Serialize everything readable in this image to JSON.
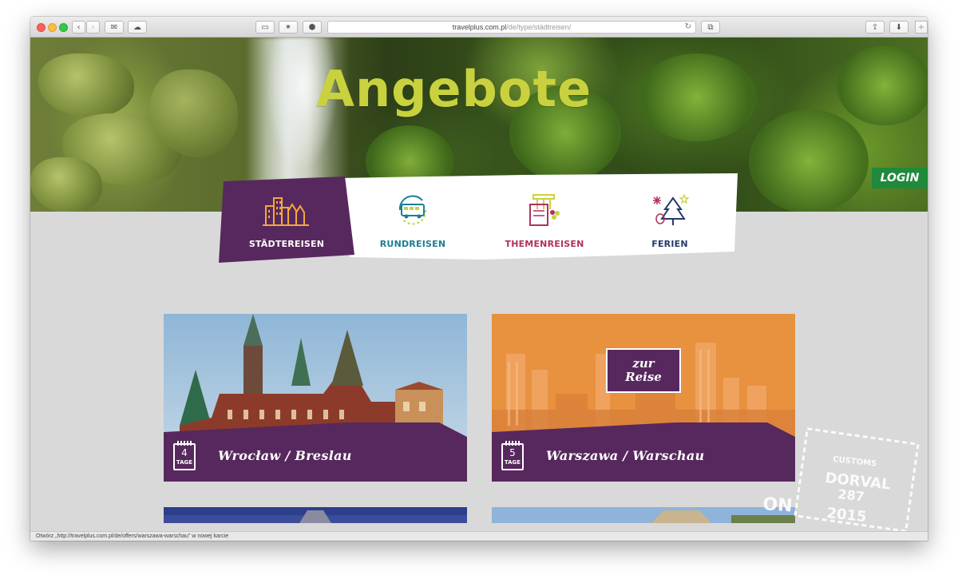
{
  "browser": {
    "url_host": "travelplus.com.pl",
    "url_path": "/de/type/städtreisen/",
    "status": "Otwórz „http://travelplus.com.pl/de/offers/warszawa-warschau\" w nowej karcie"
  },
  "hero": {
    "title": "Angebote",
    "login_label": "LOGIN"
  },
  "categories": [
    {
      "label": "STÄDTEREISEN",
      "icon": "city-buildings-icon",
      "active": true
    },
    {
      "label": "RUNDREISEN",
      "icon": "bus-circle-icon",
      "active": false
    },
    {
      "label": "THEMENREISEN",
      "icon": "columns-book-icon",
      "active": false
    },
    {
      "label": "FERIEN",
      "icon": "tree-fireworks-icon",
      "active": false
    }
  ],
  "offers": [
    {
      "title": "Wrocław / Breslau",
      "days": "4",
      "days_unit": "TAGE"
    },
    {
      "title": "Warszawa / Warschau",
      "days": "5",
      "days_unit": "TAGE",
      "hover_cta_line1": "zur",
      "hover_cta_line2": "Reise"
    }
  ],
  "stamp": {
    "line1": "CUSTOMS",
    "line2": "DORVAL",
    "line3": "287",
    "line4": "2015",
    "line5": "ON"
  },
  "colors": {
    "purple": "#57285d",
    "title_green": "#c9d23e",
    "login_green": "#1f8a3c",
    "rund_teal": "#1a7f95",
    "themen_pink": "#b03060",
    "ferien_navy": "#253a6b",
    "orange_overlay": "#e8913f"
  }
}
